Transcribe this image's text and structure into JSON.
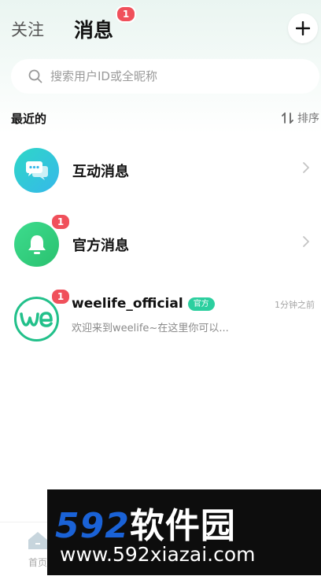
{
  "header": {
    "tab_follow": "关注",
    "tab_messages": "消息",
    "messages_badge": "1"
  },
  "search": {
    "placeholder": "搜索用户ID或全昵称"
  },
  "section": {
    "title": "最近的",
    "sort_label": "排序"
  },
  "system_rows": [
    {
      "title": "互动消息",
      "badge": "",
      "icon": "chat-bubbles-icon"
    },
    {
      "title": "官方消息",
      "badge": "1",
      "icon": "bell-icon"
    }
  ],
  "chats": [
    {
      "name": "weelife_official",
      "tag": "官方",
      "preview": "欢迎来到weelife~在这里你可以...",
      "time": "1分钟之前",
      "badge": "1",
      "avatar_text": "we"
    }
  ],
  "bottom_nav": {
    "home_label": "首页"
  },
  "watermark": {
    "number": "592",
    "name": "软件园",
    "url": "www.592xiazai.com"
  },
  "colors": {
    "accent_green": "#2ccf9f",
    "badge_red": "#f0505b",
    "interactive_gradient": [
      "#2fd7c7",
      "#35b8ea"
    ],
    "official_gradient": [
      "#3ddc8e",
      "#2ac16f"
    ]
  }
}
